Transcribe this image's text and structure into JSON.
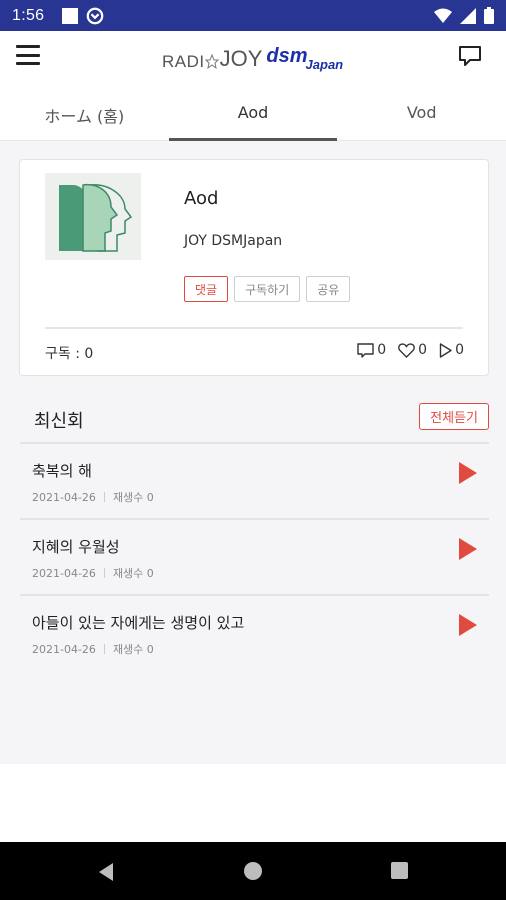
{
  "status_bar": {
    "time": "1:56"
  },
  "header": {
    "logo": {
      "radio": "RADI",
      "joy": "JOY",
      "dsm": "dsm",
      "japan": "Japan"
    }
  },
  "tabs": [
    {
      "label": "ホーム (홈)",
      "active": false
    },
    {
      "label": "Aod",
      "active": true
    },
    {
      "label": "Vod",
      "active": false
    }
  ],
  "card": {
    "title": "Aod",
    "subtitle": "JOY DSMJapan",
    "buttons": {
      "comment": "댓글",
      "subscribe": "구독하기",
      "share": "공유"
    },
    "subscribers": "구독 : 0",
    "stats": {
      "comments": "0",
      "likes": "0",
      "plays": "0"
    }
  },
  "section": {
    "title": "최신회",
    "play_all": "전체듣기"
  },
  "episodes": [
    {
      "title": "축복의 해",
      "date": "2021-04-26",
      "plays": "재생수 0"
    },
    {
      "title": "지혜의 우월성",
      "date": "2021-04-26",
      "plays": "재생수 0"
    },
    {
      "title": "아들이 있는 자에게는 생명이 있고",
      "date": "2021-04-26",
      "plays": "재생수 0"
    }
  ],
  "colors": {
    "status_bar": "#283593",
    "accent_red": "#e04a3f",
    "logo_blue": "#1a2fa8",
    "content_bg": "#f5f5f7"
  }
}
